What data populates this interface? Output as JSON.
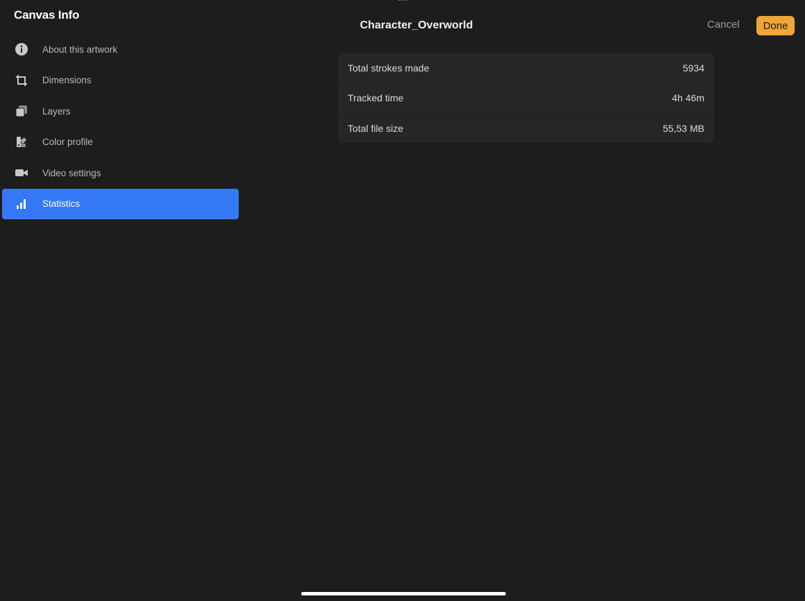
{
  "sidebar": {
    "title": "Canvas Info",
    "items": [
      {
        "label": "About this artwork",
        "icon": "info-icon",
        "active": false
      },
      {
        "label": "Dimensions",
        "icon": "crop-icon",
        "active": false
      },
      {
        "label": "Layers",
        "icon": "layers-icon",
        "active": false
      },
      {
        "label": "Color profile",
        "icon": "color-profile-icon",
        "active": false
      },
      {
        "label": "Video settings",
        "icon": "video-camera-icon",
        "active": false
      },
      {
        "label": "Statistics",
        "icon": "bar-chart-icon",
        "active": true
      }
    ]
  },
  "header": {
    "title": "Character_Overworld",
    "cancel_label": "Cancel",
    "done_label": "Done"
  },
  "statistics": [
    {
      "label": "Total strokes made",
      "value": "5934"
    },
    {
      "label": "Tracked time",
      "value": "4h 46m"
    },
    {
      "label": "Total file size",
      "value": "55,53 MB"
    }
  ],
  "colors": {
    "background": "#1d1d1d",
    "accent_active": "#3478f6",
    "done_button": "#f0a538",
    "card": "#262626"
  }
}
